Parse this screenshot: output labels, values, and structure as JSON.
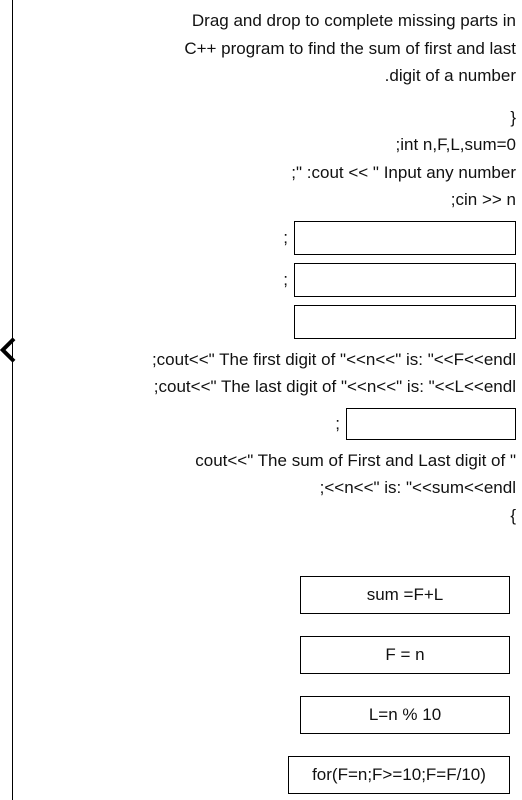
{
  "instructions": {
    "line1": "Drag and drop to complete missing parts in",
    "line2": "C++ program to find the sum of first and last",
    "line3": ".digit of a number"
  },
  "code": {
    "brace_open": "}",
    "decl": ";int n,F,L,sum=0",
    "cout_prompt": ";\" :cout << \" Input any number",
    "cin": ";cin >> n",
    "blank_sep": ";",
    "cout_first": ";cout<<\" The first digit of \"<<n<<\" is: \"<<F<<endl",
    "cout_last": ";cout<<\" The last digit of \"<<n<<\" is: \"<<L<<endl",
    "cout_sum1": "cout<<\" The sum of First and Last digit of \"",
    "cout_sum2": ";<<n<<\" is: \"<<sum<<endl",
    "brace_close": "{"
  },
  "tiles": {
    "sum": "sum =F+L",
    "f": "F = n",
    "l": "L=n % 10",
    "for": "for(F=n;F>=10;F=F/10)"
  }
}
